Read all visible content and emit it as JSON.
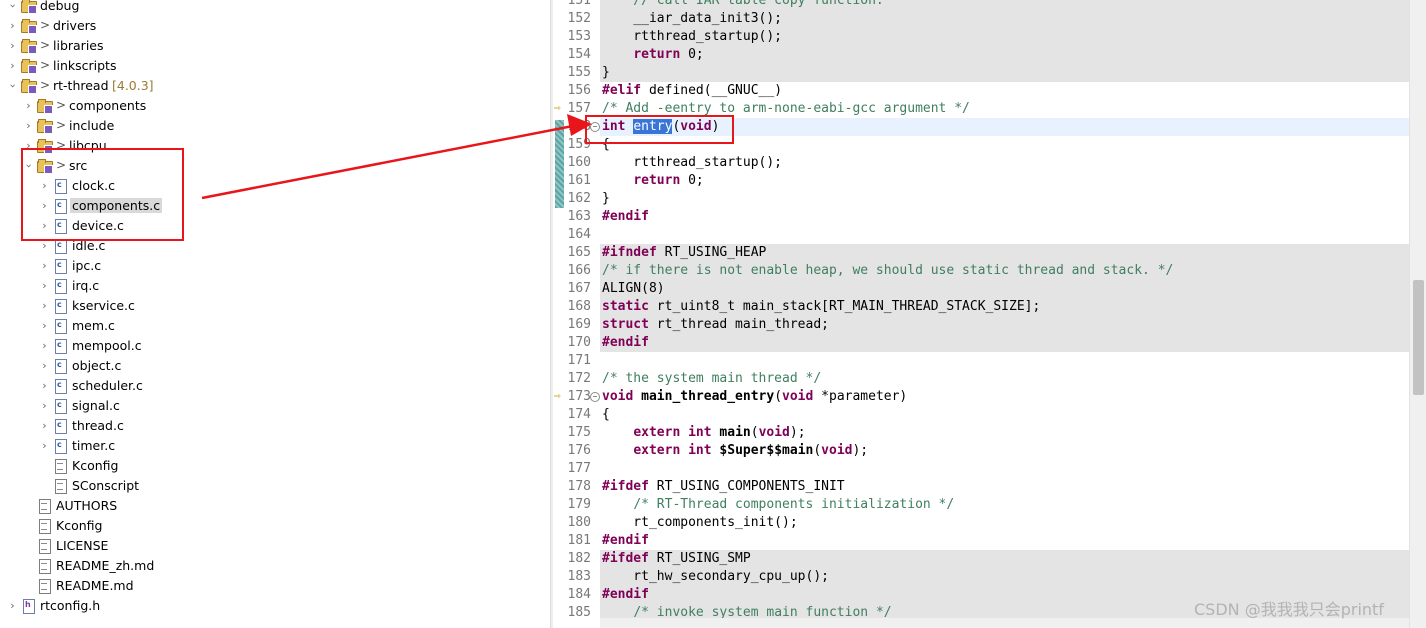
{
  "tree": {
    "items": [
      {
        "label": "debug",
        "indent": 0,
        "chev": "open",
        "kind": "folder",
        "gt": false
      },
      {
        "label": "drivers",
        "indent": 0,
        "chev": "closed",
        "kind": "folder",
        "gt": true
      },
      {
        "label": "libraries",
        "indent": 0,
        "chev": "closed",
        "kind": "folder",
        "gt": true
      },
      {
        "label": "linkscripts",
        "indent": 0,
        "chev": "closed",
        "kind": "folder",
        "gt": true
      },
      {
        "label": "rt-thread",
        "version": "[4.0.3]",
        "indent": 0,
        "chev": "open",
        "kind": "folder",
        "gt": true
      },
      {
        "label": "components",
        "indent": 1,
        "chev": "closed",
        "kind": "folder",
        "gt": true
      },
      {
        "label": "include",
        "indent": 1,
        "chev": "closed",
        "kind": "folder",
        "gt": true
      },
      {
        "label": "libcpu",
        "indent": 1,
        "chev": "closed",
        "kind": "folder",
        "gt": true
      },
      {
        "label": "src",
        "indent": 1,
        "chev": "open",
        "kind": "folder",
        "gt": true
      },
      {
        "label": "clock.c",
        "indent": 2,
        "chev": "closed",
        "kind": "cfile"
      },
      {
        "label": "components.c",
        "indent": 2,
        "chev": "closed",
        "kind": "cfile",
        "selected": true
      },
      {
        "label": "device.c",
        "indent": 2,
        "chev": "closed",
        "kind": "cfile"
      },
      {
        "label": "idle.c",
        "indent": 2,
        "chev": "closed",
        "kind": "cfile"
      },
      {
        "label": "ipc.c",
        "indent": 2,
        "chev": "closed",
        "kind": "cfile"
      },
      {
        "label": "irq.c",
        "indent": 2,
        "chev": "closed",
        "kind": "cfile"
      },
      {
        "label": "kservice.c",
        "indent": 2,
        "chev": "closed",
        "kind": "cfile"
      },
      {
        "label": "mem.c",
        "indent": 2,
        "chev": "closed",
        "kind": "cfile"
      },
      {
        "label": "mempool.c",
        "indent": 2,
        "chev": "closed",
        "kind": "cfile"
      },
      {
        "label": "object.c",
        "indent": 2,
        "chev": "closed",
        "kind": "cfile"
      },
      {
        "label": "scheduler.c",
        "indent": 2,
        "chev": "closed",
        "kind": "cfile"
      },
      {
        "label": "signal.c",
        "indent": 2,
        "chev": "closed",
        "kind": "cfile"
      },
      {
        "label": "thread.c",
        "indent": 2,
        "chev": "closed",
        "kind": "cfile"
      },
      {
        "label": "timer.c",
        "indent": 2,
        "chev": "closed",
        "kind": "cfile"
      },
      {
        "label": "Kconfig",
        "indent": 2,
        "chev": "none",
        "kind": "txtfile"
      },
      {
        "label": "SConscript",
        "indent": 2,
        "chev": "none",
        "kind": "txtfile"
      },
      {
        "label": "AUTHORS",
        "indent": 1,
        "chev": "none",
        "kind": "txtfile"
      },
      {
        "label": "Kconfig",
        "indent": 1,
        "chev": "none",
        "kind": "txtfile"
      },
      {
        "label": "LICENSE",
        "indent": 1,
        "chev": "none",
        "kind": "txtfile"
      },
      {
        "label": "README_zh.md",
        "indent": 1,
        "chev": "none",
        "kind": "txtfile"
      },
      {
        "label": "README.md",
        "indent": 1,
        "chev": "none",
        "kind": "txtfile"
      },
      {
        "label": "rtconfig.h",
        "indent": 0,
        "chev": "closed",
        "kind": "hfile"
      }
    ]
  },
  "editor": {
    "lines": [
      {
        "n": "151",
        "bg": "gray",
        "tokens": [
          [
            "cm",
            "    // call IAR table copy function."
          ]
        ]
      },
      {
        "n": "152",
        "bg": "gray",
        "tokens": [
          [
            "",
            "    __iar_data_init3();"
          ]
        ]
      },
      {
        "n": "153",
        "bg": "gray",
        "tokens": [
          [
            "",
            "    rtthread_startup();"
          ]
        ]
      },
      {
        "n": "154",
        "bg": "gray",
        "tokens": [
          [
            "",
            "    "
          ],
          [
            "kw",
            "return"
          ],
          [
            "",
            " 0;"
          ]
        ]
      },
      {
        "n": "155",
        "bg": "gray",
        "tokens": [
          [
            "",
            "}"
          ]
        ]
      },
      {
        "n": "156",
        "bg": "",
        "tokens": [
          [
            "pp",
            "#elif"
          ],
          [
            "",
            " defined(__GNUC__)"
          ]
        ]
      },
      {
        "n": "157",
        "bg": "",
        "marker": "arrow",
        "tokens": [
          [
            "cm",
            "/* Add -eentry to arm-none-eabi-gcc argument */"
          ]
        ]
      },
      {
        "n": "158",
        "bg": "cur",
        "fold": true,
        "tokens": [
          [
            "kw",
            "int"
          ],
          [
            "",
            " "
          ],
          [
            "hl",
            "entry"
          ],
          [
            "",
            "("
          ],
          [
            "kw",
            "void"
          ],
          [
            "",
            ")"
          ]
        ]
      },
      {
        "n": "159",
        "bg": "",
        "tokens": [
          [
            "",
            "{"
          ]
        ]
      },
      {
        "n": "160",
        "bg": "",
        "tokens": [
          [
            "",
            "    rtthread_startup();"
          ]
        ]
      },
      {
        "n": "161",
        "bg": "",
        "tokens": [
          [
            "",
            "    "
          ],
          [
            "kw",
            "return"
          ],
          [
            "",
            " 0;"
          ]
        ]
      },
      {
        "n": "162",
        "bg": "",
        "tokens": [
          [
            "",
            "}"
          ]
        ]
      },
      {
        "n": "163",
        "bg": "",
        "tokens": [
          [
            "pp",
            "#endif"
          ]
        ]
      },
      {
        "n": "164",
        "bg": "",
        "tokens": [
          [
            "",
            ""
          ]
        ]
      },
      {
        "n": "165",
        "bg": "gray",
        "tokens": [
          [
            "pp",
            "#ifndef"
          ],
          [
            "",
            " RT_USING_HEAP"
          ]
        ]
      },
      {
        "n": "166",
        "bg": "gray",
        "tokens": [
          [
            "cm",
            "/* if there is not enable heap, we should use static thread and stack. */"
          ]
        ]
      },
      {
        "n": "167",
        "bg": "gray",
        "tokens": [
          [
            "",
            "ALIGN(8)"
          ]
        ]
      },
      {
        "n": "168",
        "bg": "gray",
        "tokens": [
          [
            "kw",
            "static"
          ],
          [
            "",
            " rt_uint8_t main_stack[RT_MAIN_THREAD_STACK_SIZE];"
          ]
        ]
      },
      {
        "n": "169",
        "bg": "gray",
        "tokens": [
          [
            "kw",
            "struct"
          ],
          [
            "",
            " rt_thread main_thread;"
          ]
        ]
      },
      {
        "n": "170",
        "bg": "gray",
        "tokens": [
          [
            "pp",
            "#endif"
          ]
        ]
      },
      {
        "n": "171",
        "bg": "",
        "tokens": [
          [
            "",
            ""
          ]
        ]
      },
      {
        "n": "172",
        "bg": "",
        "tokens": [
          [
            "cm",
            "/* the system main thread */"
          ]
        ]
      },
      {
        "n": "173",
        "bg": "",
        "marker": "arrow",
        "fold": true,
        "tokens": [
          [
            "kw",
            "void"
          ],
          [
            "",
            " "
          ],
          [
            "fn",
            "main_thread_entry"
          ],
          [
            "",
            "("
          ],
          [
            "kw",
            "void"
          ],
          [
            "",
            " *parameter)"
          ]
        ]
      },
      {
        "n": "174",
        "bg": "",
        "tokens": [
          [
            "",
            "{"
          ]
        ]
      },
      {
        "n": "175",
        "bg": "",
        "tokens": [
          [
            "",
            "    "
          ],
          [
            "kw",
            "extern"
          ],
          [
            "",
            " "
          ],
          [
            "kw",
            "int"
          ],
          [
            "",
            " "
          ],
          [
            "fn",
            "main"
          ],
          [
            "",
            "("
          ],
          [
            "kw",
            "void"
          ],
          [
            "",
            ");"
          ]
        ]
      },
      {
        "n": "176",
        "bg": "",
        "tokens": [
          [
            "",
            "    "
          ],
          [
            "kw",
            "extern"
          ],
          [
            "",
            " "
          ],
          [
            "kw",
            "int"
          ],
          [
            "",
            " "
          ],
          [
            "fn",
            "$Super$$main"
          ],
          [
            "",
            "("
          ],
          [
            "kw",
            "void"
          ],
          [
            "",
            ");"
          ]
        ]
      },
      {
        "n": "177",
        "bg": "",
        "tokens": [
          [
            "",
            ""
          ]
        ]
      },
      {
        "n": "178",
        "bg": "",
        "tokens": [
          [
            "pp",
            "#ifdef"
          ],
          [
            "",
            " RT_USING_COMPONENTS_INIT"
          ]
        ]
      },
      {
        "n": "179",
        "bg": "",
        "tokens": [
          [
            "",
            "    "
          ],
          [
            "cm",
            "/* RT-Thread components initialization */"
          ]
        ]
      },
      {
        "n": "180",
        "bg": "",
        "tokens": [
          [
            "",
            "    rt_components_init();"
          ]
        ]
      },
      {
        "n": "181",
        "bg": "",
        "tokens": [
          [
            "pp",
            "#endif"
          ]
        ]
      },
      {
        "n": "182",
        "bg": "gray",
        "tokens": [
          [
            "pp",
            "#ifdef"
          ],
          [
            "",
            " RT_USING_SMP"
          ]
        ]
      },
      {
        "n": "183",
        "bg": "gray",
        "tokens": [
          [
            "",
            "    rt_hw_secondary_cpu_up();"
          ]
        ]
      },
      {
        "n": "184",
        "bg": "gray",
        "tokens": [
          [
            "pp",
            "#endif"
          ]
        ]
      },
      {
        "n": "185",
        "bg": "gray",
        "tokens": [
          [
            "",
            "    "
          ],
          [
            "cm",
            "/* invoke system main function */"
          ]
        ]
      }
    ]
  },
  "watermark": "CSDN @我我我只会printf"
}
